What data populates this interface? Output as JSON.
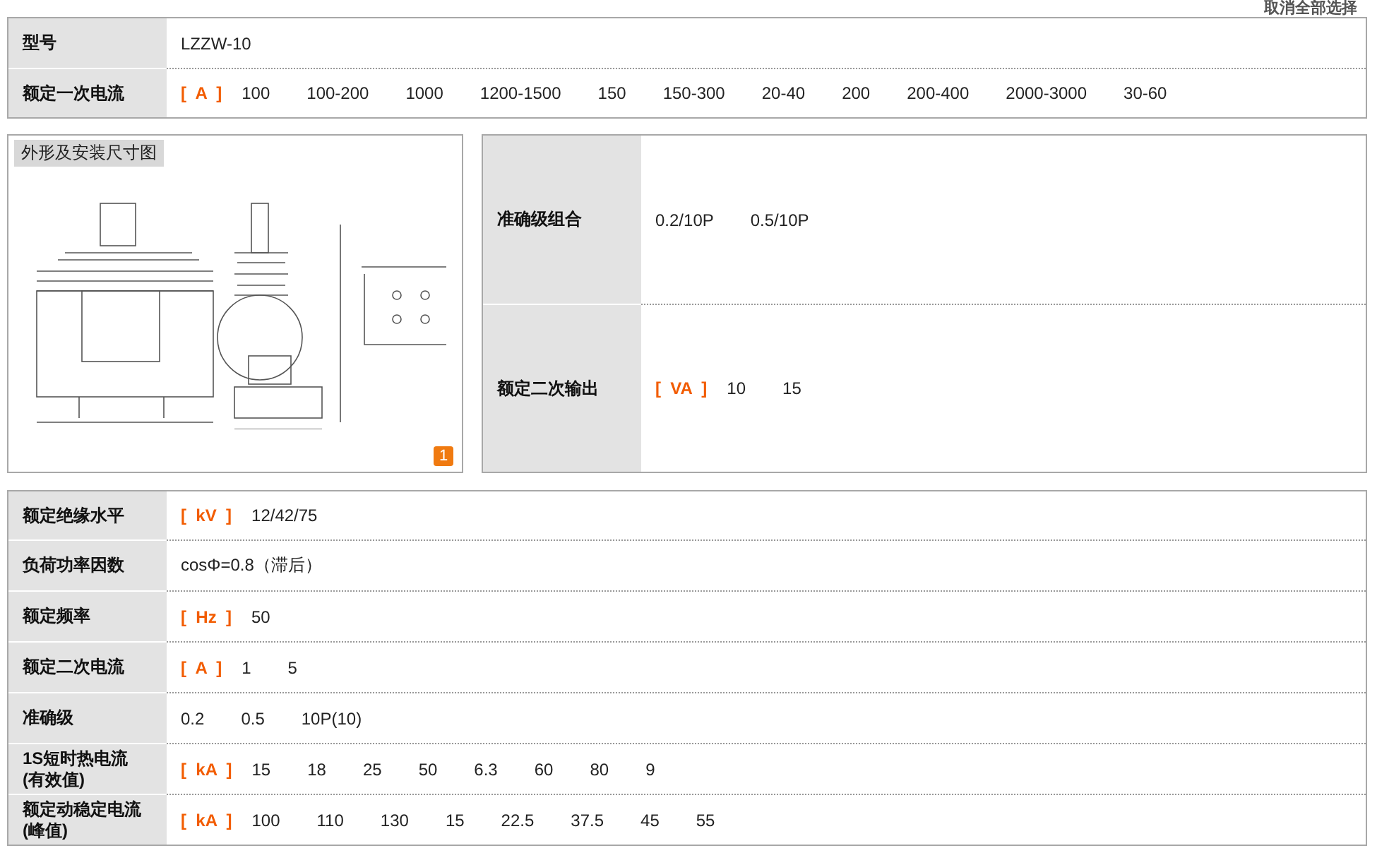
{
  "top_link": "取消全部选择",
  "top_table": [
    {
      "label": "型号",
      "values": [
        "LZZW-10"
      ]
    },
    {
      "label": "额定一次电流",
      "unit": "[  A  ]",
      "values": [
        "100",
        "100-200",
        "1000",
        "1200-1500",
        "150",
        "150-300",
        "20-40",
        "200",
        "200-400",
        "2000-3000",
        "30-60"
      ]
    }
  ],
  "figure": {
    "caption": "外形及安装尺寸图",
    "badge": "1"
  },
  "side_table": [
    {
      "label": "准确级组合",
      "values": [
        "0.2/10P",
        "0.5/10P"
      ]
    },
    {
      "label": "额定二次输出",
      "unit": "[  VA  ]",
      "values": [
        "10",
        "15"
      ]
    }
  ],
  "bottom_table": [
    {
      "label": "额定绝缘水平",
      "unit": "[  kV  ]",
      "values": [
        "12/42/75"
      ]
    },
    {
      "label": "负荷功率因数",
      "values": [
        "cosΦ=0.8（滞后）"
      ]
    },
    {
      "label": "额定频率",
      "unit": "[  Hz  ]",
      "values": [
        "50"
      ]
    },
    {
      "label": "额定二次电流",
      "unit": "[  A  ]",
      "values": [
        "1",
        "5"
      ]
    },
    {
      "label": "准确级",
      "values": [
        "0.2",
        "0.5",
        "10P(10)"
      ]
    },
    {
      "label": "1S短时热电流",
      "sublabel": "(有效值)",
      "unit": "[  kA  ]",
      "values": [
        "15",
        "18",
        "25",
        "50",
        "6.3",
        "60",
        "80",
        "9"
      ]
    },
    {
      "label": "额定动稳定电流",
      "sublabel": "(峰值)",
      "unit": "[  kA  ]",
      "values": [
        "100",
        "110",
        "130",
        "15",
        "22.5",
        "37.5",
        "45",
        "55"
      ]
    }
  ]
}
